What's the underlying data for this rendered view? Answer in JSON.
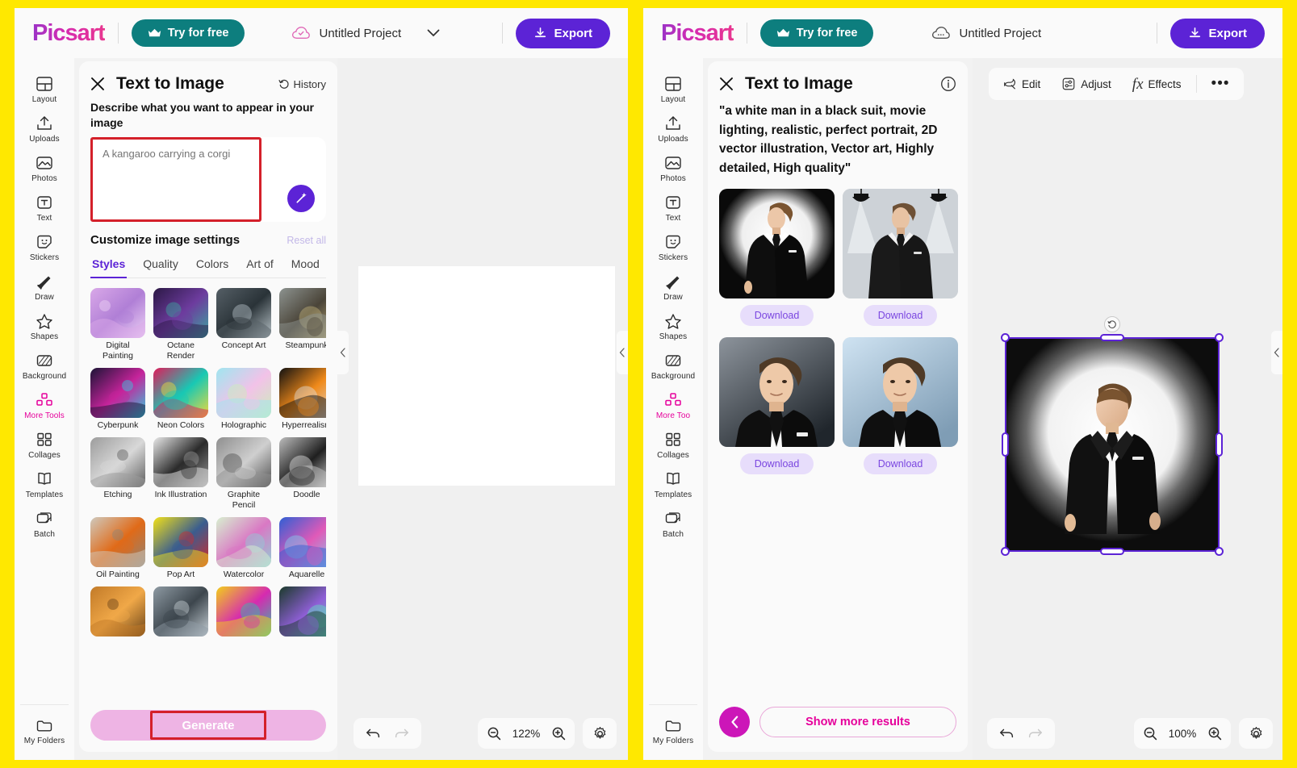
{
  "app": {
    "brand": "Picsart",
    "try_for_free": "Try for free",
    "project_name": "Untitled Project",
    "export": "Export"
  },
  "sidebar": {
    "items": [
      {
        "label": "Layout",
        "icon": "layout-icon"
      },
      {
        "label": "Uploads",
        "icon": "upload-icon"
      },
      {
        "label": "Photos",
        "icon": "photo-icon"
      },
      {
        "label": "Text",
        "icon": "text-icon"
      },
      {
        "label": "Stickers",
        "icon": "sticker-icon"
      },
      {
        "label": "Draw",
        "icon": "brush-icon"
      },
      {
        "label": "Shapes",
        "icon": "star-icon"
      },
      {
        "label": "Background",
        "icon": "background-icon"
      },
      {
        "label": "More Tools",
        "icon": "more-tools-icon"
      },
      {
        "label": "Collages",
        "icon": "collage-icon"
      },
      {
        "label": "Templates",
        "icon": "template-icon"
      },
      {
        "label": "Batch",
        "icon": "batch-icon"
      }
    ],
    "items_right": [
      {
        "label": "Layout"
      },
      {
        "label": "Uploads"
      },
      {
        "label": "Photos"
      },
      {
        "label": "Text"
      },
      {
        "label": "Stickers"
      },
      {
        "label": "Draw"
      },
      {
        "label": "Shapes"
      },
      {
        "label": "Background"
      },
      {
        "label": "More Too"
      },
      {
        "label": "Collages"
      },
      {
        "label": "Templates"
      },
      {
        "label": "Batch"
      }
    ],
    "footer": {
      "label": "My Folders",
      "icon": "folder-icon"
    },
    "active": "More Tools"
  },
  "left_panel": {
    "tool_title": "Text to Image",
    "history_label": "History",
    "describe_label": "Describe what you want to appear in your image",
    "prompt_placeholder": "A kangaroo carrying a corgi",
    "prompt_value": "",
    "settings_title": "Customize image settings",
    "reset_all": "Reset all",
    "tabs": [
      {
        "label": "Styles",
        "active": true
      },
      {
        "label": "Quality",
        "active": false
      },
      {
        "label": "Colors",
        "active": false
      },
      {
        "label": "Art of",
        "active": false
      },
      {
        "label": "Mood",
        "active": false
      }
    ],
    "styles": [
      {
        "label": "Digital Painting",
        "c1": "#d9a8e8",
        "c2": "#b07fd6",
        "c3": "#f0d5f7"
      },
      {
        "label": "Octane Render",
        "c1": "#2b1845",
        "c2": "#6d3c9e",
        "c3": "#3ba8a0"
      },
      {
        "label": "Concept Art",
        "c1": "#555f66",
        "c2": "#2a3338",
        "c3": "#b9c4c9"
      },
      {
        "label": "Steampunk",
        "c1": "#8d9390",
        "c2": "#4a4438",
        "c3": "#c2b27a"
      },
      {
        "label": "Cyberpunk",
        "c1": "#1b1436",
        "c2": "#c6249b",
        "c3": "#2ed0e0"
      },
      {
        "label": "Neon Colors",
        "c1": "#e01b5a",
        "c2": "#18c8b4",
        "c3": "#f2d93b"
      },
      {
        "label": "Holographic",
        "c1": "#9fe6f0",
        "c2": "#f2c2e8",
        "c3": "#c9f0b8"
      },
      {
        "label": "Hyperrealism",
        "c1": "#111111",
        "c2": "#f08a1a",
        "c3": "#dedede"
      },
      {
        "label": "Etching",
        "c1": "#9c9c9c",
        "c2": "#d8d8d8",
        "c3": "#5e5e5e"
      },
      {
        "label": "Ink Illustration",
        "c1": "#e9e9e9",
        "c2": "#2b2b2b",
        "c3": "#9a9a9a"
      },
      {
        "label": "Graphite Pencil",
        "c1": "#8f8f8f",
        "c2": "#cfcfcf",
        "c3": "#4d4d4d"
      },
      {
        "label": "Doodle",
        "c1": "#bdbdbd",
        "c2": "#1f1f1f",
        "c3": "#e4e4e4"
      },
      {
        "label": "Oil Painting",
        "c1": "#cfc9bd",
        "c2": "#e06a18",
        "c3": "#8d8478"
      },
      {
        "label": "Pop Art",
        "c1": "#f2e119",
        "c2": "#3a5d8f",
        "c3": "#d42a2a"
      },
      {
        "label": "Watercolor",
        "c1": "#d8f0d0",
        "c2": "#d978c4",
        "c3": "#8fcfd6"
      },
      {
        "label": "Aquarelle",
        "c1": "#2f5fd4",
        "c2": "#e05ab8",
        "c3": "#7fd0f0"
      },
      {
        "label": "",
        "c1": "#c27a28",
        "c2": "#f0a848",
        "c3": "#6a4318"
      },
      {
        "label": "",
        "c1": "#8e9aa3",
        "c2": "#3d464d",
        "c3": "#c9d2d8"
      },
      {
        "label": "",
        "c1": "#f2cf1a",
        "c2": "#d62ab0",
        "c3": "#2fc4a8"
      },
      {
        "label": "",
        "c1": "#1a3a2a",
        "c2": "#8f5fd6",
        "c3": "#5fe0c0"
      }
    ],
    "generate_label": "Generate",
    "zoom_level": "122%",
    "undo_icon": "undo-icon",
    "redo_icon": "redo-icon",
    "zoom_out_icon": "zoom-out-icon",
    "zoom_in_icon": "zoom-in-icon",
    "settings_icon": "gear-icon"
  },
  "right_panel": {
    "tool_title": "Text to Image",
    "prompt_echo": "\"a white man in a black suit, movie lighting, realistic, perfect portrait, 2D vector illustration, Vector art, Highly detailed, High quality\"",
    "results": [
      {
        "download_label": "Download",
        "variant": "halo-fullbody"
      },
      {
        "download_label": "Download",
        "variant": "spotlights"
      },
      {
        "download_label": "Download",
        "variant": "dark-portrait"
      },
      {
        "download_label": "Download",
        "variant": "blue-portrait"
      }
    ],
    "show_more_label": "Show more results",
    "editor_toolbar": [
      {
        "label": "Edit",
        "icon": "edit-icon"
      },
      {
        "label": "Adjust",
        "icon": "adjust-icon"
      },
      {
        "label": "Effects",
        "icon": "effects-icon"
      }
    ],
    "more_options_label": "•••",
    "zoom_level": "100%"
  },
  "colors": {
    "frame": "#ffe800",
    "brand_purple": "#5c23d6",
    "brand_pink": "#e6009b",
    "teal": "#0d7e7e",
    "highlight_red": "#d4202a",
    "download_purple": "#7a46e0"
  }
}
